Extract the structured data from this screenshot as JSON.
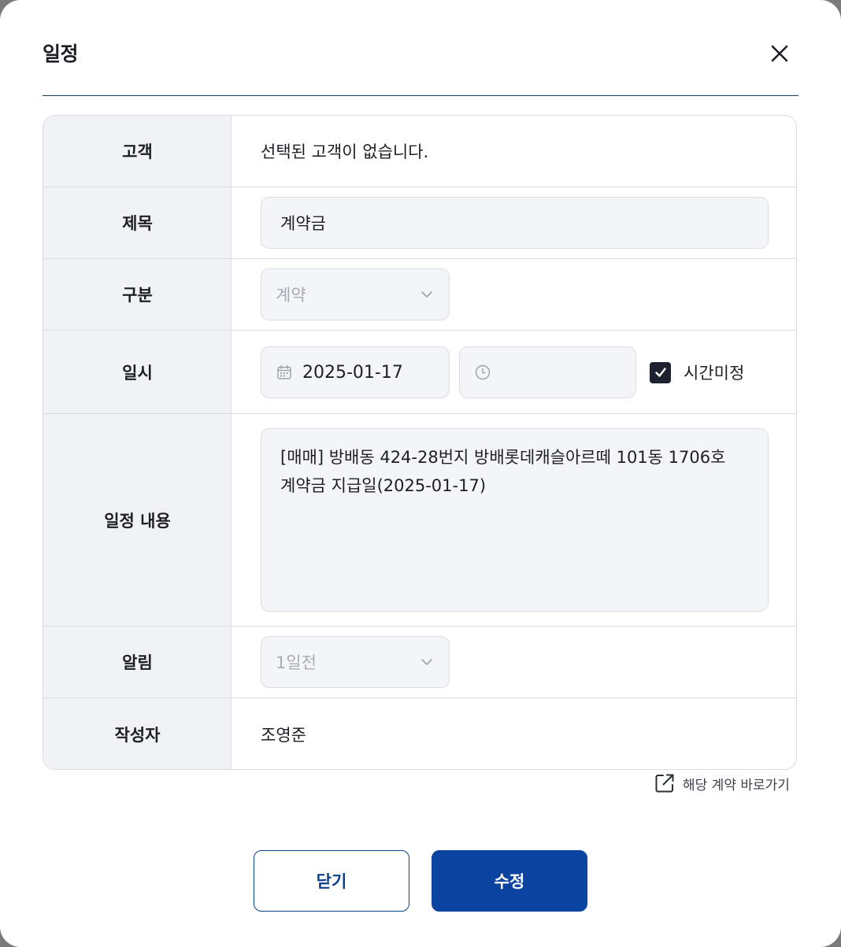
{
  "modal": {
    "title": "일정",
    "close_icon": "close-icon"
  },
  "form": {
    "customer": {
      "label": "고객",
      "value": "선택된 고객이 없습니다."
    },
    "title": {
      "label": "제목",
      "value": "계약금"
    },
    "category": {
      "label": "구분",
      "selected": "계약",
      "icon": "chevron-down-icon"
    },
    "datetime": {
      "label": "일시",
      "date": "2025-01-17",
      "time": "",
      "date_icon": "calendar-icon",
      "time_icon": "clock-icon",
      "time_unset_checked": true,
      "time_unset_label": "시간미정"
    },
    "content": {
      "label": "일정 내용",
      "line1": "[매매] 방배동 424-28번지 방배롯데캐슬아르떼 101동 1706호",
      "line2": "계약금 지급일(2025-01-17)"
    },
    "alarm": {
      "label": "알림",
      "selected": "1일전",
      "icon": "chevron-down-icon"
    },
    "author": {
      "label": "작성자",
      "value": "조영준"
    }
  },
  "contract_link": {
    "label": "해당 계약 바로가기",
    "icon": "external-link-icon"
  },
  "buttons": {
    "close_label": "닫기",
    "edit_label": "수정"
  },
  "colors": {
    "primary": "#0a43a0",
    "header_line": "#143c5e",
    "label_bg": "#f0f2f5",
    "input_bg": "#f4f5f8",
    "checkbox": "#1c2230"
  }
}
